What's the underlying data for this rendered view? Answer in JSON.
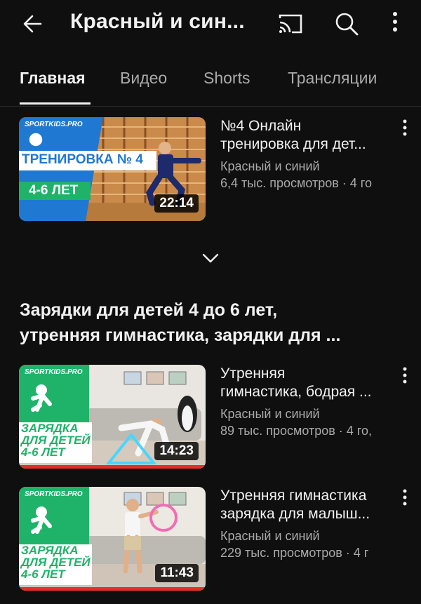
{
  "header": {
    "title": "Красный и син...",
    "icons": [
      "back-arrow-icon",
      "cast-icon",
      "search-icon",
      "more-vert-icon"
    ]
  },
  "tabs": [
    {
      "label": "Главная",
      "active": true
    },
    {
      "label": "Видео",
      "active": false
    },
    {
      "label": "Shorts",
      "active": false
    },
    {
      "label": "Трансляции",
      "active": false
    }
  ],
  "featured": {
    "title_lines": [
      "№4 Онлайн",
      "тренировка для дет..."
    ],
    "channel": "Красный и синий",
    "meta": "6,4 тыс. просмотров · 4 го",
    "duration": "22:14",
    "thumb": {
      "brand": "SPORTKIDS.PRO",
      "line1": "ТРЕНИРОВКА № 4",
      "line2": "4-6 ЛЕТ"
    }
  },
  "section": {
    "title_lines": [
      "Зарядки для детей 4 до 6 лет,",
      "утренняя гимнастика, зарядки для ..."
    ]
  },
  "videos": [
    {
      "title_lines": [
        "Утренняя",
        "гимнастика, бодрая ..."
      ],
      "channel": "Красный и синий",
      "meta": "89 тыс. просмотров · 4 го,",
      "duration": "14:23",
      "watched": true,
      "thumb": {
        "brand": "SPORTKIDS.PRO",
        "lines": [
          "ЗАРЯДКА",
          "ДЛЯ ДЕТЕЙ",
          "4-6 ЛЕТ"
        ]
      }
    },
    {
      "title_lines": [
        "Утренняя гимнастика",
        "зарядка для малыш..."
      ],
      "channel": "Красный и синий",
      "meta": "229 тыс. просмотров · 4 г",
      "duration": "11:43",
      "watched": true,
      "thumb": {
        "brand": "SPORTKIDS.PRO",
        "lines": [
          "ЗАРЯДКА",
          "ДЛЯ ДЕТЕЙ",
          "4-6 ЛЕТ"
        ]
      }
    }
  ],
  "colors": {
    "background": "#0f0f0f",
    "text_primary": "#f1f1f1",
    "text_secondary": "#aaaaaa",
    "progress": "#e52d27",
    "thumb_green": "#1fb36a",
    "thumb_blue": "#1f78d1"
  }
}
